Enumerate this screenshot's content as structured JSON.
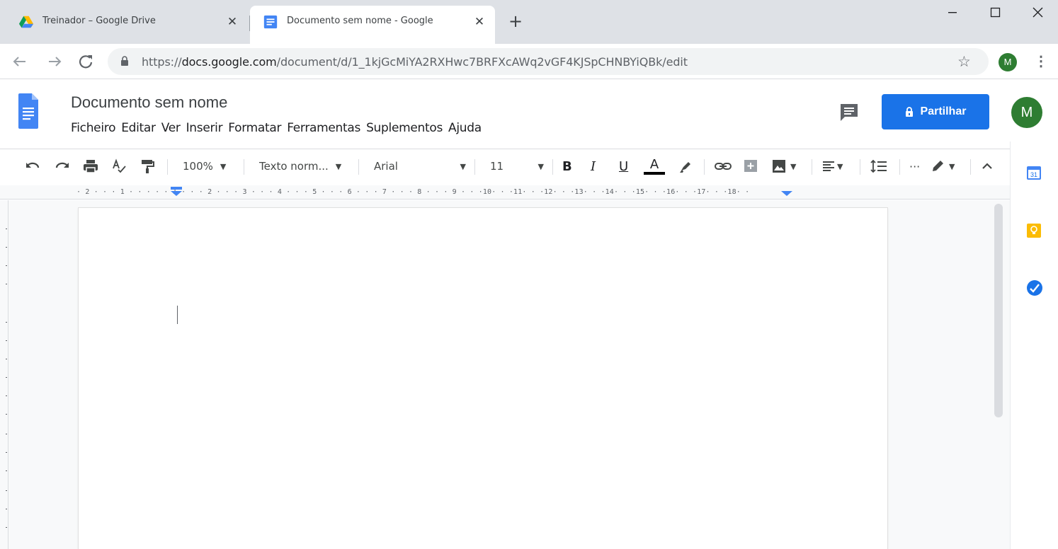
{
  "browser": {
    "tabs": [
      {
        "title": "Treinador – Google Drive",
        "active": false,
        "icon": "google-drive-icon"
      },
      {
        "title": "Documento sem nome - Google",
        "active": true,
        "icon": "google-docs-icon"
      }
    ],
    "url_scheme": "https://",
    "url_host": "docs.google.com",
    "url_path": "/document/d/1_1kjGcMiYA2RXHwc7BRFXcAWq2vGF4KJSpCHNBYiQBk/edit",
    "profile_initial": "M"
  },
  "docs": {
    "title": "Documento sem nome",
    "menu": [
      "Ficheiro",
      "Editar",
      "Ver",
      "Inserir",
      "Formatar",
      "Ferramentas",
      "Suplementos",
      "Ajuda"
    ],
    "share_label": "Partilhar",
    "account_initial": "M"
  },
  "toolbar": {
    "zoom": "100%",
    "style": "Texto norm...",
    "font": "Arial",
    "font_size": "11",
    "bold": "B",
    "italic": "I",
    "underline": "U",
    "text_color": "A"
  },
  "ruler": {
    "labels": "· 2 ·  ·  · 1 ·  ·  ·     ·  · 1 ·  ·  · 2 ·  ·  · 3 ·  ·  · 4 ·  ·  · 5 ·  ·  · 6 ·  ·  · 7 ·  ·  · 8 ·  ·  · 9 ·  ·  ·10·  ·  ·11·  ·  ·12·  ·  ·13·  ·  ·14·  ·  ·15·  ·  ·16·  ·  ·17·  ·  ·18·  ·"
  },
  "side_panel": {
    "calendar_day": "31"
  },
  "colors": {
    "accent": "#1a73e8",
    "avatar": "#2e7d32",
    "chrome": "#dee1e6"
  }
}
